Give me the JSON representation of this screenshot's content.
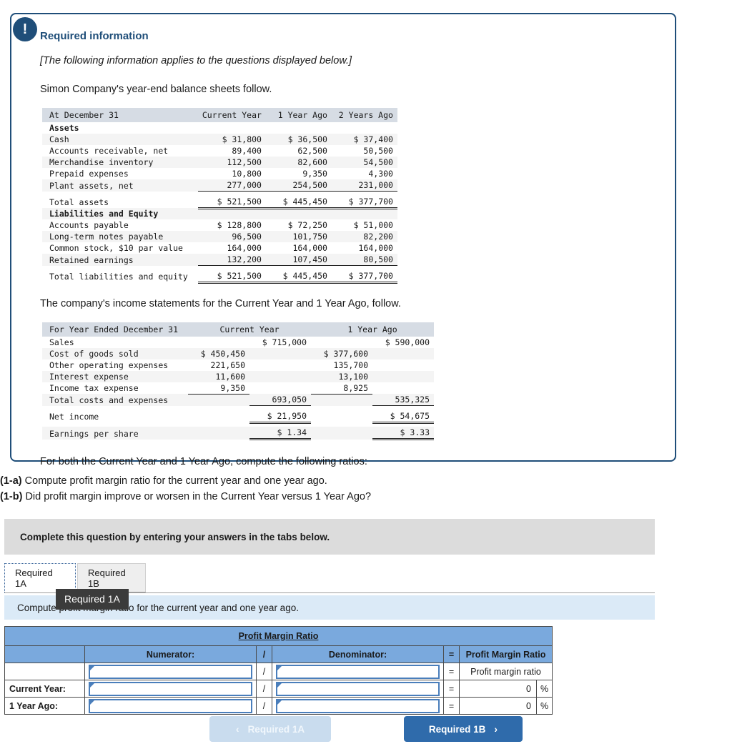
{
  "panel": {
    "icon": "exclamation-icon",
    "title": "Required information",
    "applies_note": "[The following information applies to the questions displayed below.]",
    "intro": "Simon Company's year-end balance sheets follow.",
    "mid_text": "The company's income statements for the Current Year and 1 Year Ago, follow.",
    "closing": "For both the Current Year and 1 Year Ago, compute the following ratios:"
  },
  "balance_sheet": {
    "headers": [
      "At December 31",
      "Current Year",
      "1 Year Ago",
      "2 Years Ago"
    ],
    "rows": [
      {
        "label": "Assets",
        "bold": true,
        "values": [
          "",
          "",
          ""
        ]
      },
      {
        "label": "Cash",
        "values": [
          "$ 31,800",
          "$ 36,500",
          "$ 37,400"
        ]
      },
      {
        "label": "Accounts receivable, net",
        "values": [
          "89,400",
          "62,500",
          "50,500"
        ]
      },
      {
        "label": "Merchandise inventory",
        "values": [
          "112,500",
          "82,600",
          "54,500"
        ]
      },
      {
        "label": "Prepaid expenses",
        "values": [
          "10,800",
          "9,350",
          "4,300"
        ]
      },
      {
        "label": "Plant assets, net",
        "values": [
          "277,000",
          "254,500",
          "231,000"
        ],
        "underline": true
      },
      {
        "label": "Total assets",
        "values": [
          "$ 521,500",
          "$ 445,450",
          "$ 377,700"
        ],
        "double": true
      },
      {
        "label": "Liabilities and Equity",
        "bold": true,
        "values": [
          "",
          "",
          ""
        ]
      },
      {
        "label": "Accounts payable",
        "values": [
          "$ 128,800",
          "$ 72,250",
          "$ 51,000"
        ]
      },
      {
        "label": "Long-term notes payable",
        "values": [
          "96,500",
          "101,750",
          "82,200"
        ]
      },
      {
        "label": "Common stock, $10 par value",
        "values": [
          "164,000",
          "164,000",
          "164,000"
        ]
      },
      {
        "label": "Retained earnings",
        "values": [
          "132,200",
          "107,450",
          "80,500"
        ],
        "underline": true
      },
      {
        "label": "Total liabilities and equity",
        "values": [
          "$ 521,500",
          "$ 445,450",
          "$ 377,700"
        ],
        "double": true
      }
    ]
  },
  "income_statement": {
    "headers": [
      "For Year Ended December 31",
      "Current Year",
      "1 Year Ago"
    ],
    "rows": [
      {
        "label": "Sales",
        "c1": "",
        "c2": "$ 715,000",
        "c3": "",
        "c4": "$ 590,000"
      },
      {
        "label": "Cost of goods sold",
        "c1": "$ 450,450",
        "c2": "",
        "c3": "$ 377,600",
        "c4": ""
      },
      {
        "label": "Other operating expenses",
        "c1": "221,650",
        "c2": "",
        "c3": "135,700",
        "c4": ""
      },
      {
        "label": "Interest expense",
        "c1": "11,600",
        "c2": "",
        "c3": "13,100",
        "c4": ""
      },
      {
        "label": "Income tax expense",
        "c1": "9,350",
        "c2": "",
        "c3": "8,925",
        "c4": "",
        "underline_inner": true
      },
      {
        "label": "Total costs and expenses",
        "c1": "",
        "c2": "693,050",
        "c3": "",
        "c4": "535,325",
        "underline_outer": true
      },
      {
        "label": "Net income",
        "c1": "",
        "c2": "$ 21,950",
        "c3": "",
        "c4": "$ 54,675",
        "double_outer": true
      },
      {
        "label": "Earnings per share",
        "c1": "",
        "c2": "$ 1.34",
        "c3": "",
        "c4": "$ 3.33",
        "double_outer": true
      }
    ]
  },
  "question_stems": [
    {
      "num": "(1-a)",
      "text": " Compute profit margin ratio for the current year and one year ago."
    },
    {
      "num": "(1-b)",
      "text": " Did profit margin improve or worsen in the Current Year versus 1 Year Ago?"
    }
  ],
  "complete_bar": {
    "text": "Complete this question by entering your answers in the tabs below."
  },
  "tabs": [
    {
      "label": "Required 1A",
      "active": true
    },
    {
      "label": "Required 1B",
      "active": false
    }
  ],
  "tooltip": {
    "text": "Required 1A"
  },
  "blue_prompt": {
    "text": "Compute profit margin ratio for the current year and one year ago."
  },
  "answer_table": {
    "title": "Profit Margin Ratio",
    "col_headers": {
      "rowlabel": "",
      "numerator": "Numerator:",
      "slash": "/",
      "denominator": "Denominator:",
      "equals": "=",
      "result": "Profit Margin Ratio"
    },
    "rows": [
      {
        "label": "",
        "slash": "/",
        "equals": "=",
        "result": "Profit margin ratio",
        "result_type": "text",
        "pct": ""
      },
      {
        "label": "Current Year:",
        "slash": "/",
        "equals": "=",
        "result": "0",
        "result_type": "num",
        "pct": "%"
      },
      {
        "label": "1 Year Ago:",
        "slash": "/",
        "equals": "=",
        "result": "0",
        "result_type": "num",
        "pct": "%"
      }
    ]
  },
  "nav": {
    "prev_label": "Required 1A",
    "prev_chevron": "chevron-left-icon",
    "next_label": "Required 1B",
    "next_chevron": "chevron-right-icon"
  },
  "colors": {
    "panel_border": "#1f4e79",
    "title_blue": "#1f4e79",
    "table_header_gray": "#d6dce4",
    "answer_header_blue": "#7aa9dd",
    "prompt_blue": "#dbeaf7",
    "complete_gray": "#dcdcdc",
    "next_button": "#2f6bab",
    "prev_button": "#c9dcee",
    "input_border": "#4a7ebb",
    "tooltip_bg": "#3b3b3b"
  }
}
